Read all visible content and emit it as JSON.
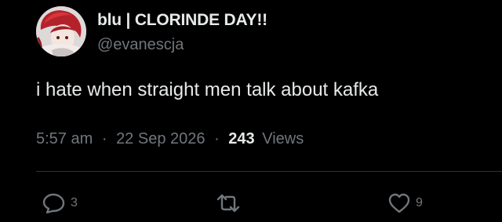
{
  "author": {
    "display_name": "blu | CLORINDE DAY!!",
    "handle": "@evanescja"
  },
  "tweet": {
    "text": "i hate when straight men talk about kafka"
  },
  "meta": {
    "time": "5:57 am",
    "separator_1": "·",
    "date": "22 Sep 2026",
    "separator_2": "·",
    "views_count": "243",
    "views_label": "Views"
  },
  "actions": {
    "reply_icon": "speech-bubble",
    "reply_count": "3",
    "retweet_icon": "retweet-arrows",
    "retweet_count": "",
    "like_icon": "heart-outline",
    "like_count": "9"
  },
  "colors": {
    "background": "#000000",
    "primary_text": "#e7e9ea",
    "secondary_text": "#71767b",
    "divider": "#2f3336"
  }
}
